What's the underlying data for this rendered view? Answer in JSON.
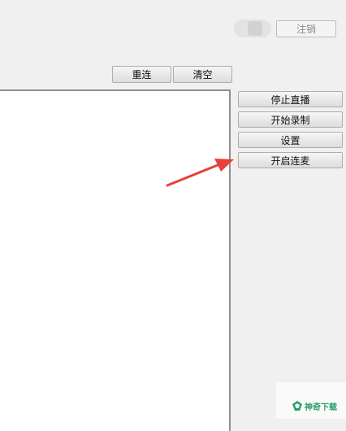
{
  "header": {
    "logout_label": "注销"
  },
  "toolbar": {
    "reconnect_label": "重连",
    "clear_label": "清空"
  },
  "side_buttons": {
    "stop_live_label": "停止直播",
    "start_recording_label": "开始录制",
    "settings_label": "设置",
    "start_co_stream_label": "开启连麦"
  },
  "watermark": {
    "text": "神奇下载"
  },
  "colors": {
    "arrow": "#e8403a",
    "watermark": "#2a9d6a"
  }
}
